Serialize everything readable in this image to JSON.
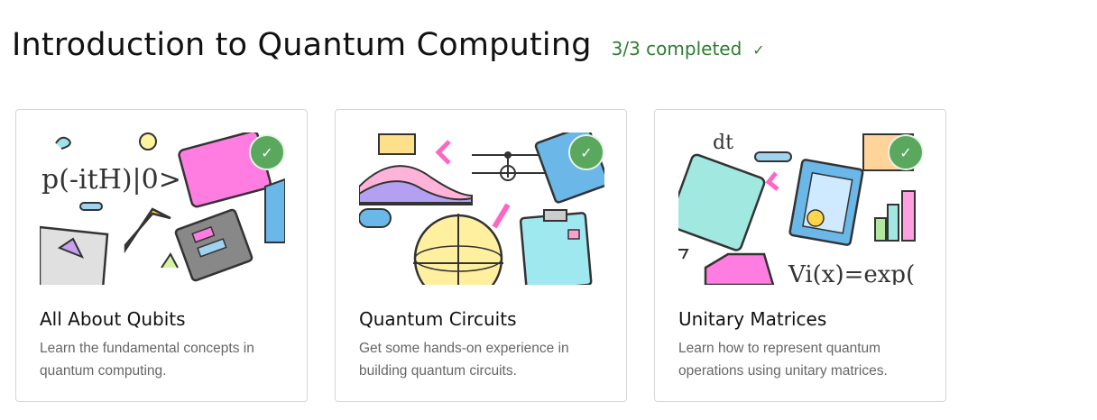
{
  "course": {
    "title": "Introduction to Quantum Computing",
    "progress_text": "3/3 completed",
    "progress_icon": "check-icon",
    "accent_color": "#2e7d32"
  },
  "lessons": [
    {
      "title": "All About Qubits",
      "description": "Learn the fundamental concepts in quantum computing.",
      "completed": true,
      "image_formula": "p(-itH)|0>"
    },
    {
      "title": "Quantum Circuits",
      "description": "Get some hands-on experience in building quantum circuits.",
      "completed": true,
      "image_formula": ""
    },
    {
      "title": "Unitary Matrices",
      "description": "Learn how to represent quantum operations using unitary matrices.",
      "completed": true,
      "image_formula": "Vi(x)=exp("
    }
  ],
  "badge": {
    "icon": "checkmark-icon",
    "color": "#5aa85e"
  }
}
